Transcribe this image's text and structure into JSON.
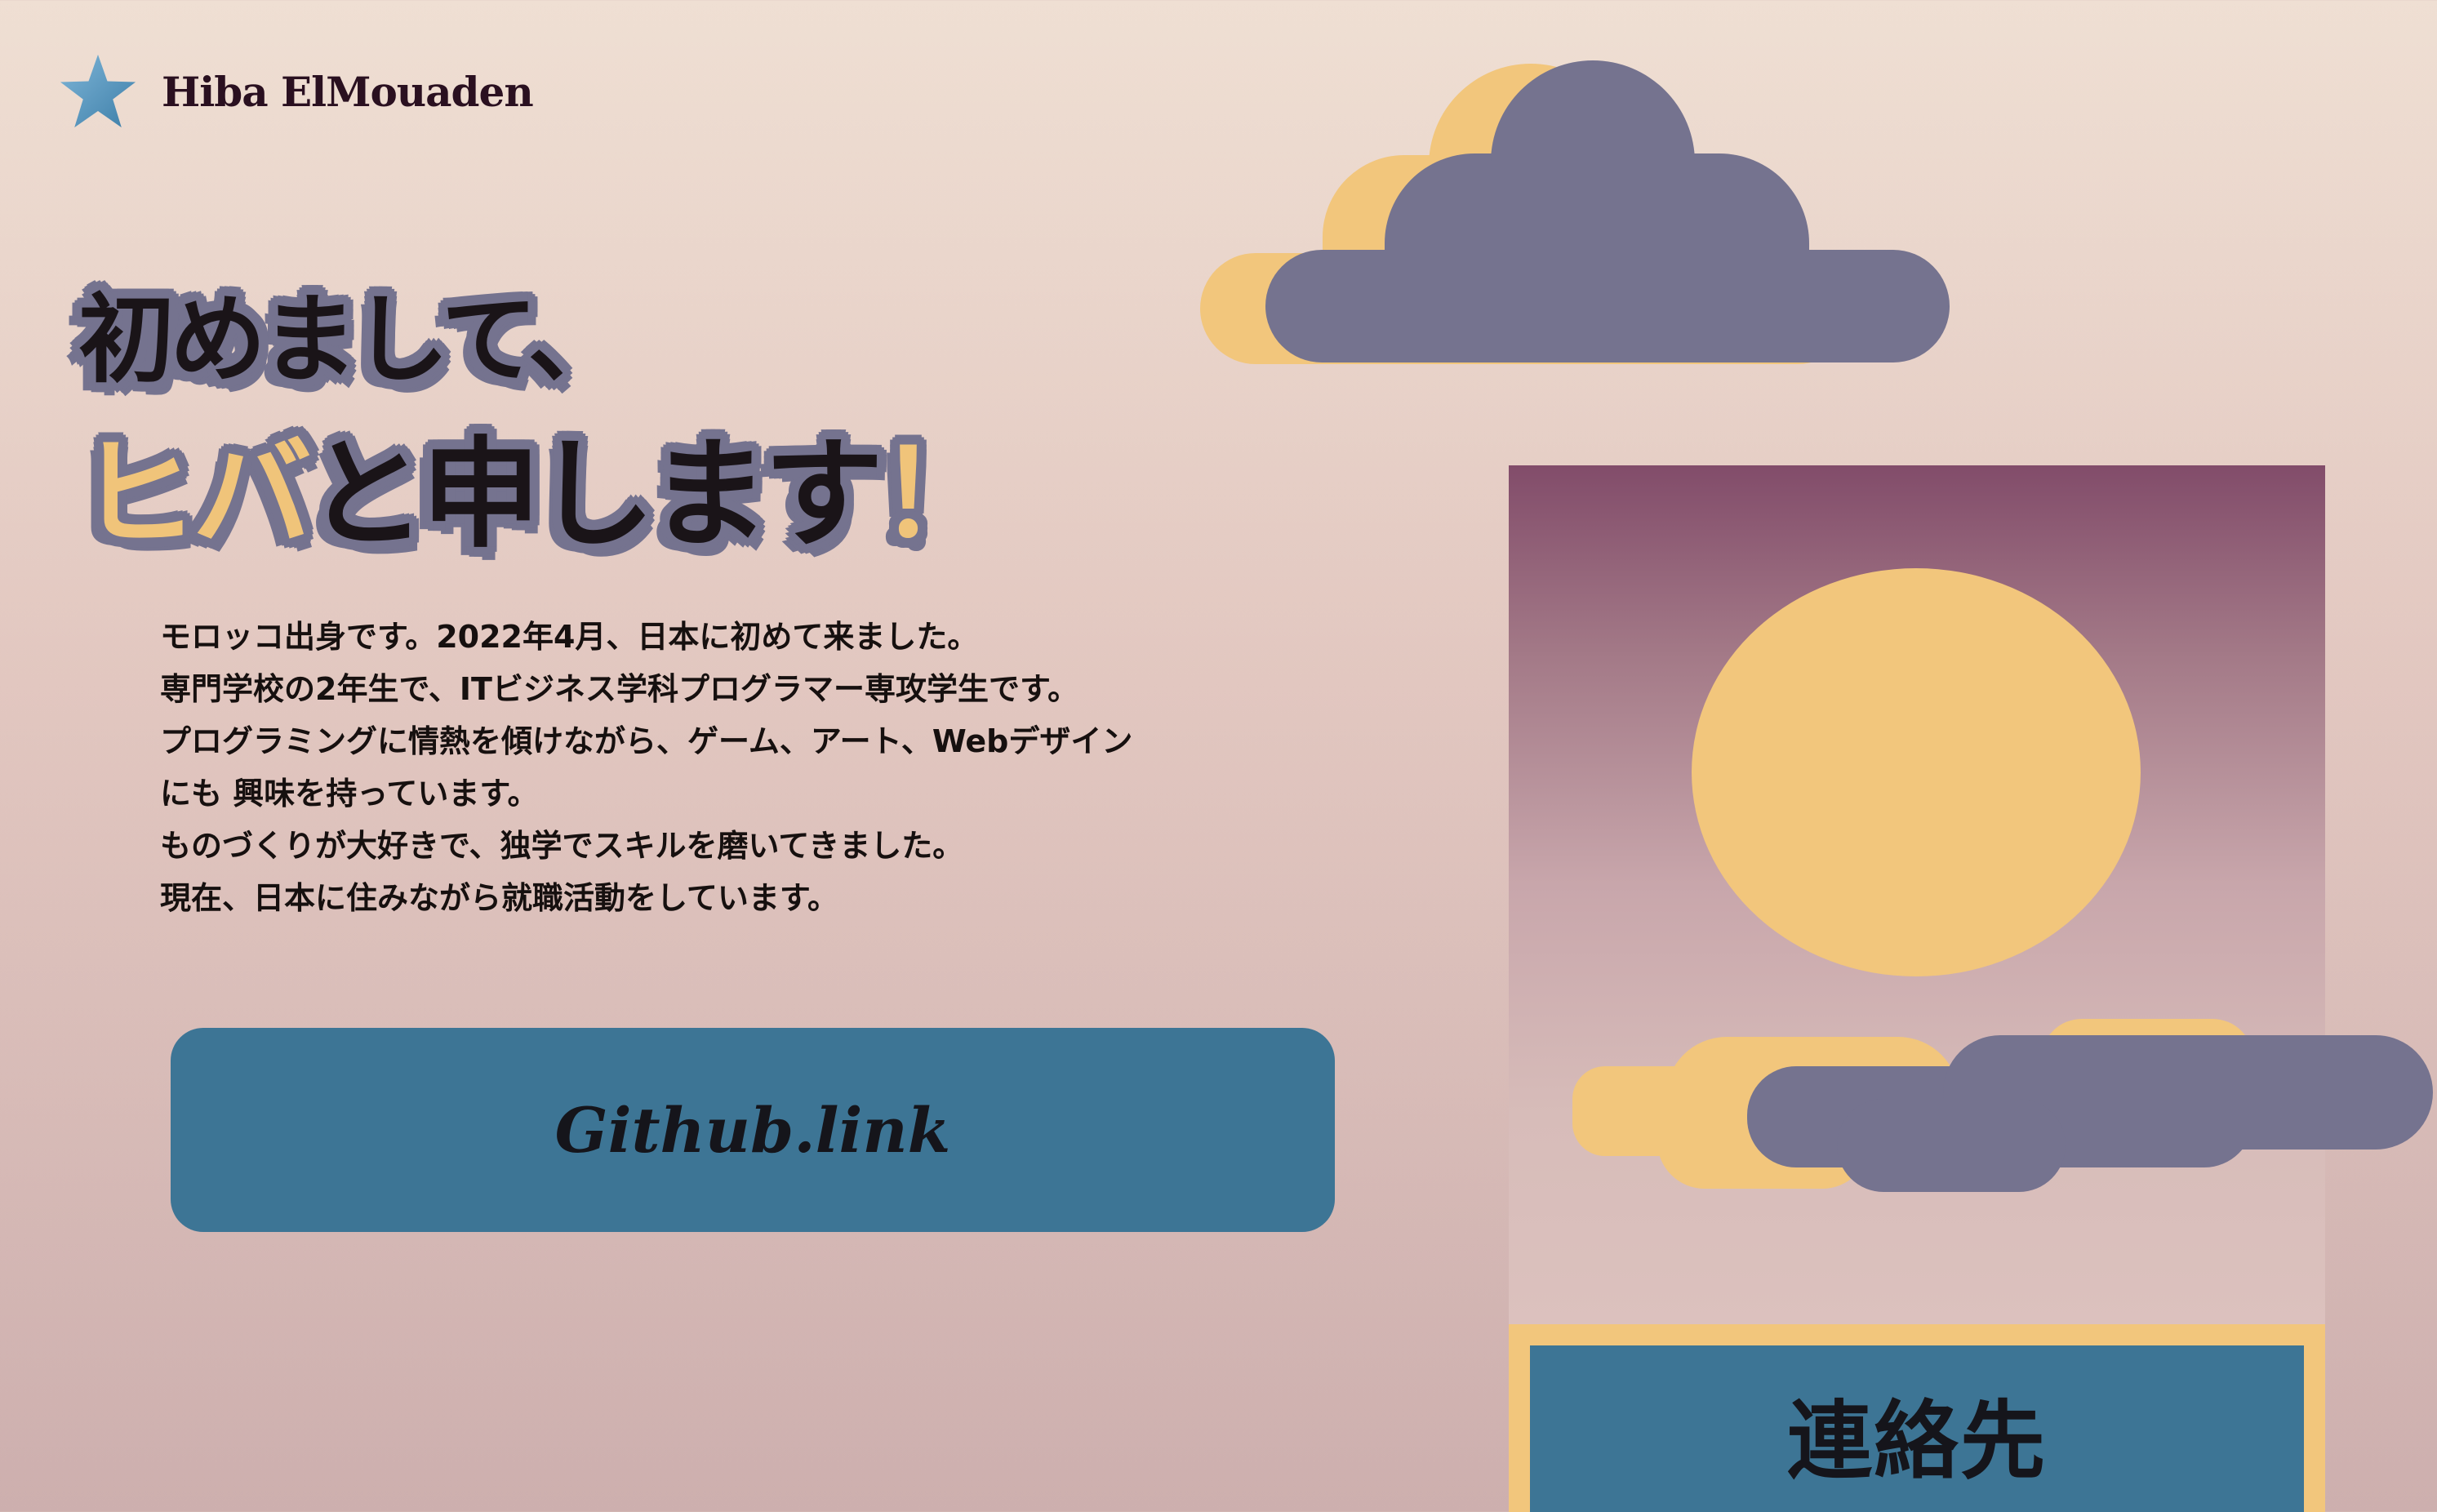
{
  "header": {
    "logo_icon": "star-icon",
    "name": "Hiba ElMouaden"
  },
  "headline": {
    "line1": "初めまして、",
    "line2_accent": "ヒバ",
    "line2_rest": "と申します",
    "line2_mark": "！"
  },
  "intro": {
    "lines": [
      "モロッコ出身です。2022年4月、日本に初めて来ました。",
      "専門学校の2年生で、ITビジネス学科プログラマー専攻学生です。",
      "プログラミングに情熱を傾けながら、ゲーム、アート、Webデザイン",
      "にも 興味を持っています。",
      "ものづくりが大好きで、独学でスキルを磨いてきました。",
      "現在、日本に住みながら就職活動をしています。"
    ]
  },
  "github_button": {
    "label": "Github.link"
  },
  "contact_button": {
    "label": "連絡先"
  },
  "colors": {
    "accent_blue": "#3d7595",
    "moon_yellow": "#f2c67c",
    "cloud_purple": "#75738f",
    "panel_top": "#824c6a"
  }
}
